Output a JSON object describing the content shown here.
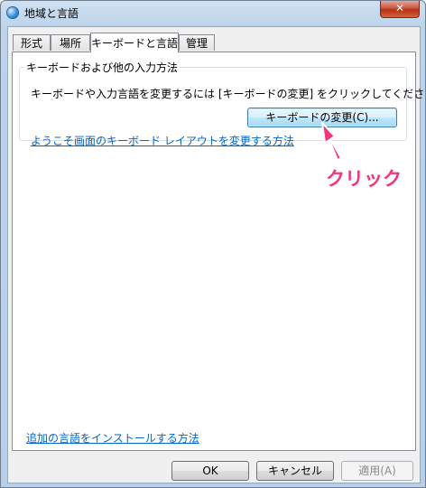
{
  "window": {
    "title": "地域と言語",
    "close_label": "✕"
  },
  "tabs": [
    {
      "label": "形式"
    },
    {
      "label": "場所"
    },
    {
      "label": "キーボードと言語"
    },
    {
      "label": "管理"
    }
  ],
  "keyboard_group": {
    "legend": "キーボードおよび他の入力方法",
    "description": "キーボードや入力言語を変更するには [キーボードの変更] をクリックしてください。",
    "change_button_label": "キーボードの変更(C)...",
    "welcome_link": "ようこそ画面のキーボード レイアウトを変更する方法"
  },
  "install_link": "追加の言語をインストールする方法",
  "footer": {
    "ok_label": "OK",
    "cancel_label": "キャンセル",
    "apply_label": "適用(A)"
  },
  "annotation": {
    "label": "クリック",
    "color": "#f2357c"
  }
}
